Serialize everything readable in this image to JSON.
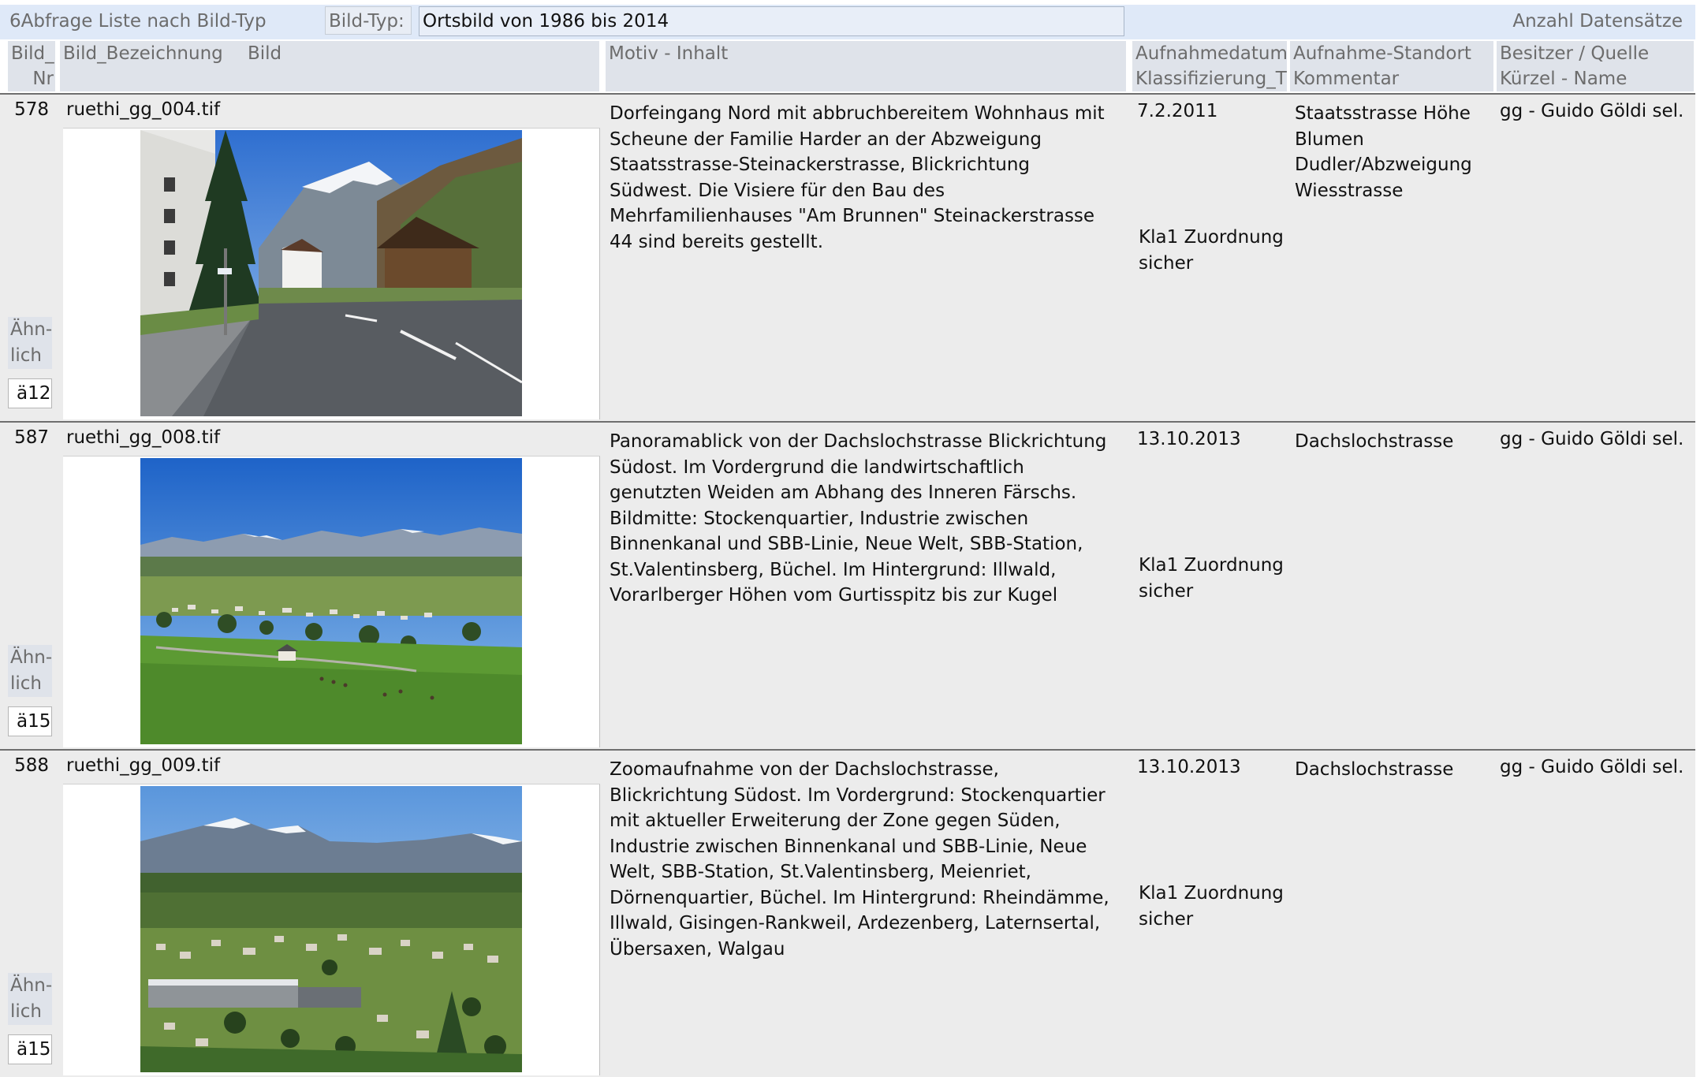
{
  "header": {
    "title": "6Abfrage Liste nach Bild-Typ",
    "filter_label": "Bild-Typ:",
    "filter_value": "Ortsbild von 1986 bis 2014",
    "count_label": "Anzahl Datensätze"
  },
  "columns": {
    "bild_nr_1": "Bild_",
    "bild_nr_2": "Nr",
    "bild_bezeichnung": "Bild_Bezeichnung",
    "bild": "Bild",
    "motiv": "Motiv - Inhalt",
    "datum_1": "Aufnahmedatum",
    "datum_2": "Klassifizierung_T",
    "standort_1": "Aufnahme-Standort",
    "standort_2": "Kommentar",
    "besitzer_1": "Besitzer / Quelle",
    "besitzer_2": "Kürzel - Name"
  },
  "records": [
    {
      "nr": "578",
      "name": "ruethi_gg_004.tif",
      "photo_icon": "street-village-photo",
      "aehn_label": "Ähn-lich",
      "aehn_value": "ä12",
      "motiv": "Dorfeingang Nord mit abbruchbereitem Wohnhaus mit Scheune der Familie Harder an der Abzweigung Staatsstrasse-Steinackerstrasse, Blickrichtung Südwest. Die Visiere für den Bau des Mehrfamilienhauses \"Am Brunnen\" Steinackerstrasse 44 sind bereits gestellt.",
      "date": "7.2.2011",
      "klass": "Kla1 Zuordnung sicher",
      "standort": "Staatsstrasse Höhe Blumen Dudler/Abzweigung Wiesstrasse",
      "besitzer": "gg - Guido Göldi sel."
    },
    {
      "nr": "587",
      "name": "ruethi_gg_008.tif",
      "photo_icon": "panorama-valley-photo",
      "aehn_label": "Ähn-lich",
      "aehn_value": "ä15",
      "motiv": "Panoramablick von der Dachslochstrasse Blickrichtung Südost. Im Vordergrund die landwirtschaftlich genutzten Weiden am Abhang des Inneren Färschs. Bildmitte: Stockenquartier, Industrie zwischen Binnenkanal und SBB-Linie, Neue Welt, SBB-Station, St.Valentinsberg, Büchel. Im Hintergrund: Illwald, Vorarlberger Höhen vom Gurtisspitz bis zur Kugel",
      "date": "13.10.2013",
      "klass": "Kla1 Zuordnung sicher",
      "standort": "Dachslochstrasse",
      "besitzer": "gg - Guido Göldi sel."
    },
    {
      "nr": "588",
      "name": "ruethi_gg_009.tif",
      "photo_icon": "zoom-village-photo",
      "aehn_label": "Ähn-lich",
      "aehn_value": "ä15",
      "motiv": "Zoomaufnahme von der Dachslochstrasse, Blickrichtung Südost. Im Vordergrund: Stockenquartier mit aktueller Erweiterung der Zone gegen Süden, Industrie zwischen Binnenkanal und SBB-Linie, Neue Welt, SBB-Station, St.Valentinsberg, Meienriet, Dörnenquartier, Büchel. Im Hintergrund: Rheindämme, Illwald, Gisingen-Rankweil, Ardezenberg, Laternsertal, Übersaxen, Walgau",
      "date": "13.10.2013",
      "klass": "Kla1 Zuordnung sicher",
      "standort": "Dachslochstrasse",
      "besitzer": "gg - Guido Göldi sel."
    }
  ]
}
